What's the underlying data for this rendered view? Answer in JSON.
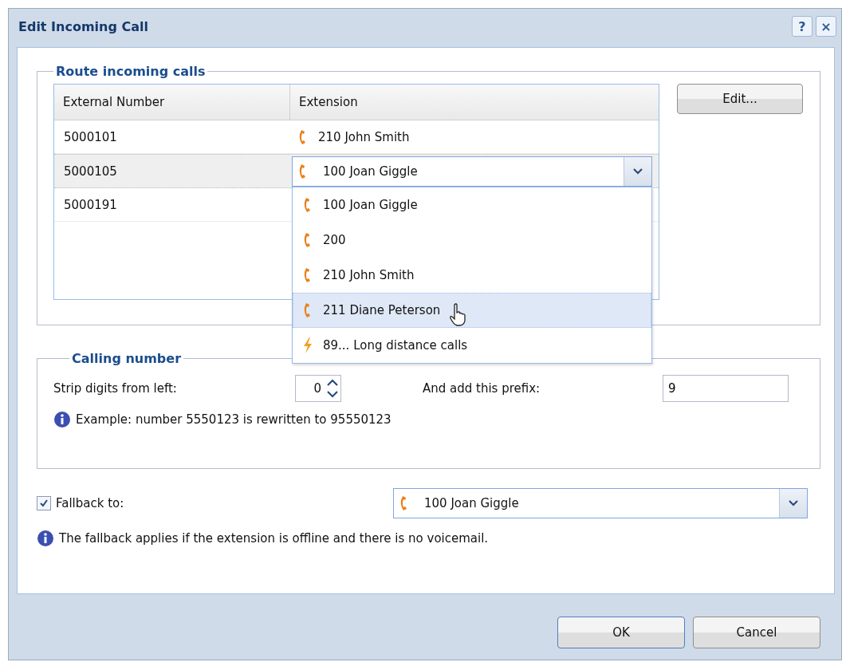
{
  "window": {
    "title": "Edit Incoming Call",
    "buttons": [
      "?",
      "×"
    ]
  },
  "route": {
    "legend": "Route incoming calls",
    "columns": [
      "External Number",
      "Extension"
    ],
    "rows": [
      {
        "external": "5000101",
        "extension": "210 John Smith",
        "selected": false,
        "editing": false
      },
      {
        "external": "5000105",
        "extension": "100 Joan Giggle",
        "selected": true,
        "editing": true
      },
      {
        "external": "5000191",
        "extension": "",
        "selected": false,
        "editing": false
      }
    ],
    "dropdown": [
      {
        "kind": "phone",
        "label": "100 Joan Giggle",
        "selected": false
      },
      {
        "kind": "phone",
        "label": "200",
        "selected": false
      },
      {
        "kind": "phone",
        "label": "210 John Smith",
        "selected": false
      },
      {
        "kind": "phone",
        "label": "211 Diane Peterson",
        "selected": true
      },
      {
        "kind": "lightning",
        "label": "89... Long distance calls",
        "selected": false
      }
    ],
    "edit_button": "Edit..."
  },
  "calling": {
    "legend": "Calling number",
    "strip_label": "Strip digits from left:",
    "strip_value": "0",
    "prefix_label": "And add this prefix:",
    "prefix_value": "9",
    "example": "Example: number 5550123 is rewritten to 95550123"
  },
  "fallback": {
    "checked": true,
    "label": "Fallback to:",
    "value": "100 Joan Giggle",
    "info": "The fallback applies if the extension is offline and there is no voicemail."
  },
  "buttons": [
    "OK",
    "Cancel"
  ]
}
